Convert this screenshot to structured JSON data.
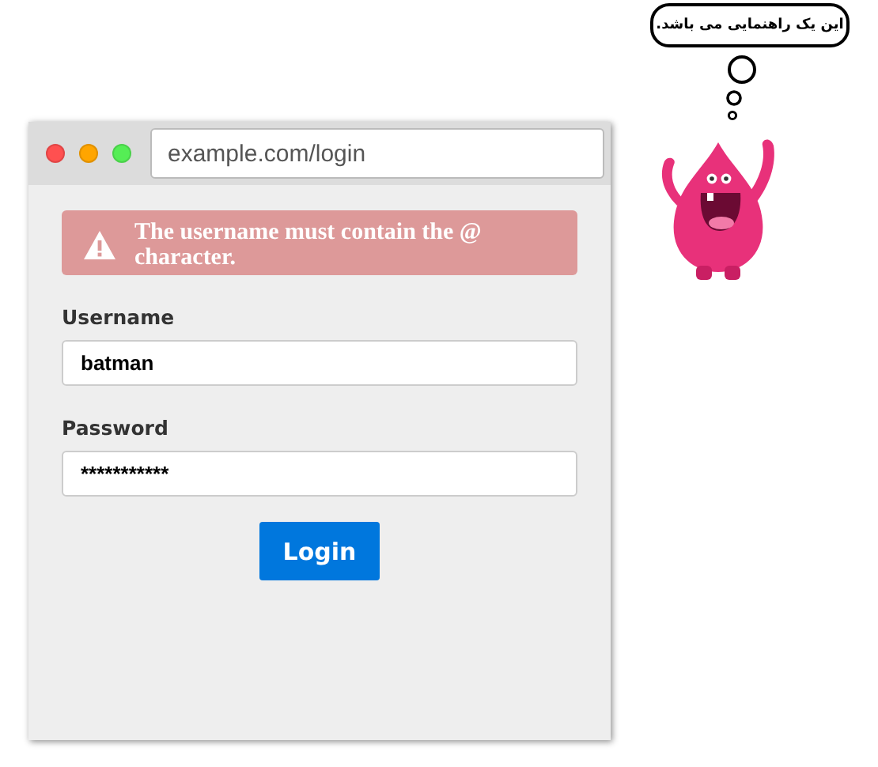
{
  "browser": {
    "url": "example.com/login",
    "controls": [
      {
        "color": "#ff5050"
      },
      {
        "color": "#ffa500"
      },
      {
        "color": "#55ee55"
      }
    ]
  },
  "alert": {
    "text": "The username must contain the @ character."
  },
  "form": {
    "fields": [
      {
        "label": "Username",
        "value": "batman"
      },
      {
        "label": "Password",
        "value": "***********"
      }
    ],
    "button": "Login"
  },
  "helper": {
    "bubble": "این یک راهنمایی می باشد."
  }
}
